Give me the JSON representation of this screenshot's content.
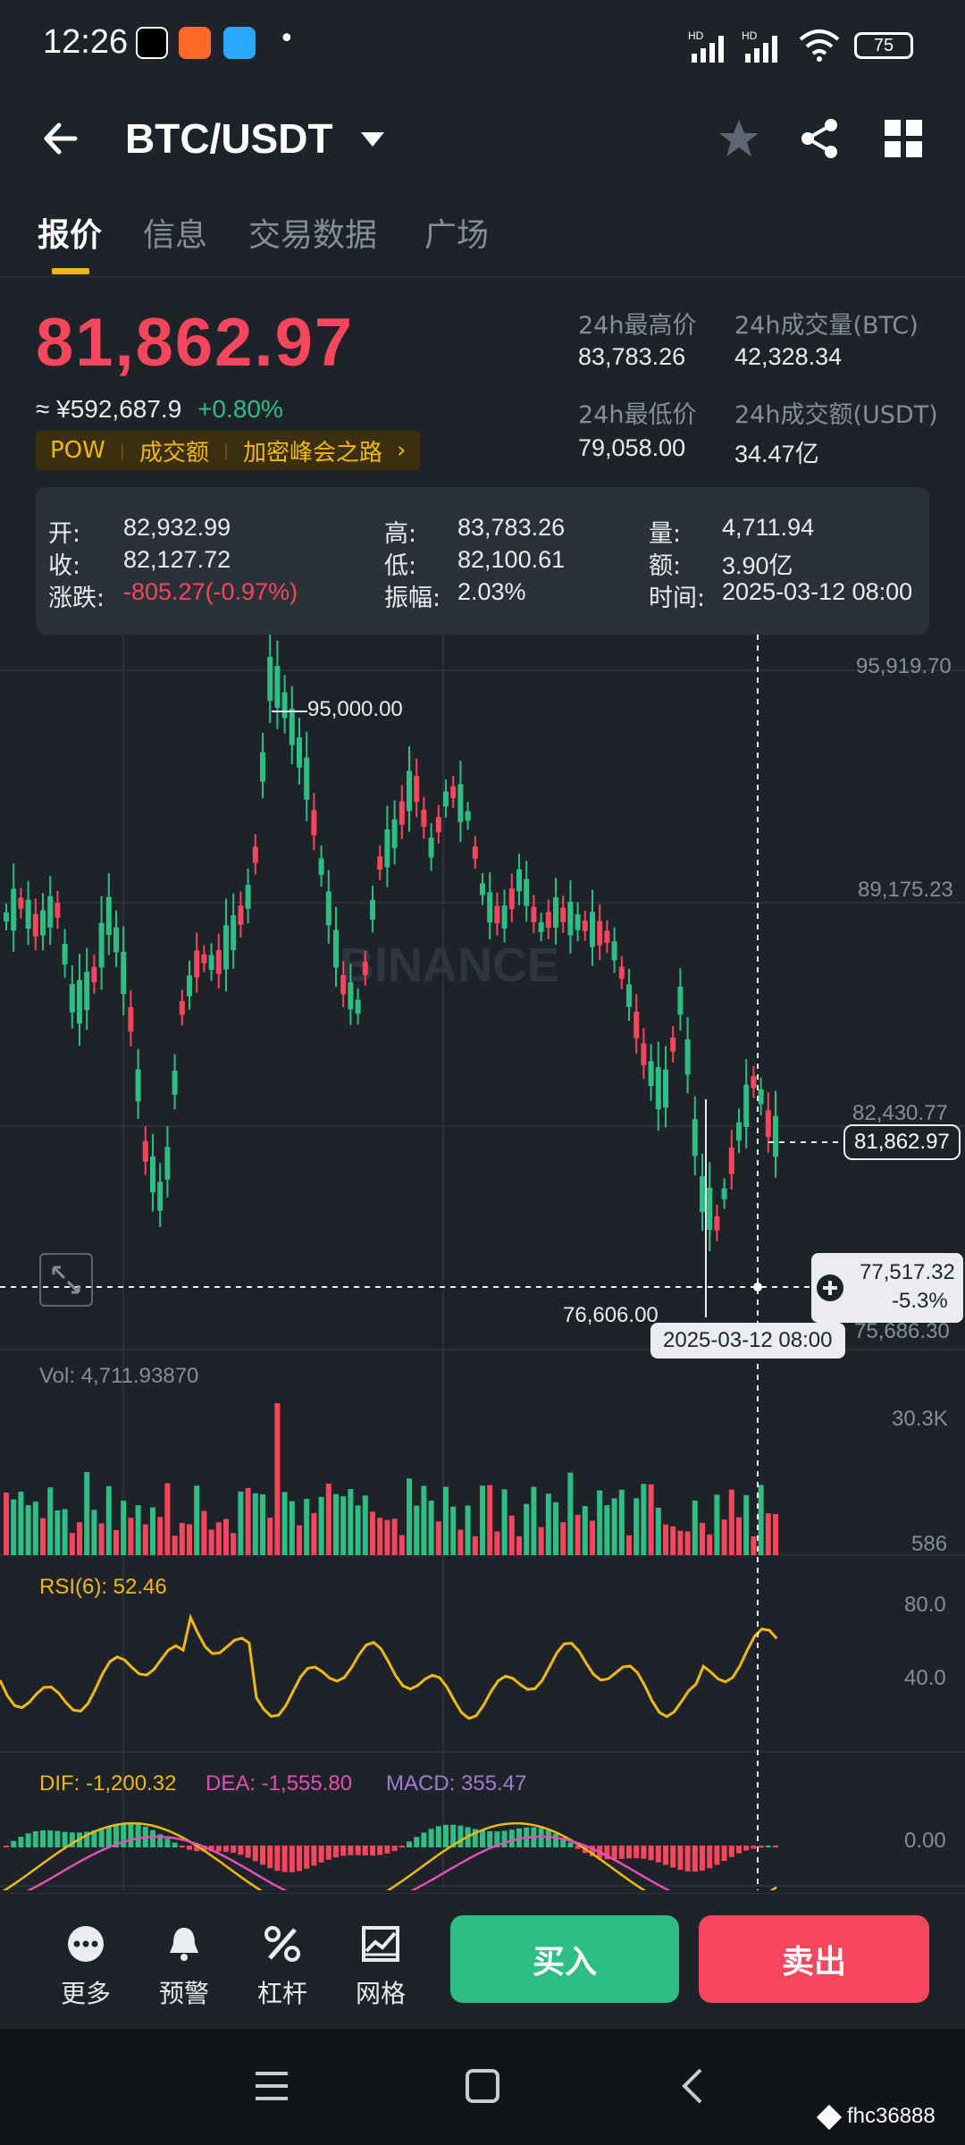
{
  "status_bar": {
    "time": "12:26",
    "battery": "75",
    "dot": "•"
  },
  "header": {
    "pair": "BTC/USDT",
    "back_icon": "arrow-left-icon",
    "star_icon": "star-icon",
    "share_icon": "share-icon",
    "grid_icon": "grid-icon"
  },
  "tabs": [
    {
      "label": "报价",
      "active": true
    },
    {
      "label": "信息",
      "active": false
    },
    {
      "label": "交易数据",
      "active": false
    },
    {
      "label": "广场",
      "active": false
    }
  ],
  "ticker": {
    "last_price": "81,862.97",
    "cny_price": "≈ ¥592,687.9",
    "change_pct": "+0.80%",
    "tags": [
      "POW",
      "成交额",
      "加密峰会之路"
    ],
    "tag_arrow": "›",
    "high_24h_label": "24h最高价",
    "high_24h": "83,783.26",
    "low_24h_label": "24h最低价",
    "low_24h": "79,058.00",
    "vol_btc_label": "24h成交量(BTC)",
    "vol_btc": "42,328.34",
    "vol_usdt_label": "24h成交额(USDT)",
    "vol_usdt": "34.47亿"
  },
  "ohlc_panel": {
    "open_label": "开:",
    "open": "82,932.99",
    "close_label": "收:",
    "close": "82,127.72",
    "change_label": "涨跌:",
    "change": "-805.27(-0.97%)",
    "high_label": "高:",
    "high": "83,783.26",
    "low_label": "低:",
    "low": "82,100.61",
    "amp_label": "振幅:",
    "amp": "2.03%",
    "vol_label": "量:",
    "vol": "4,711.94",
    "amount_label": "额:",
    "amount": "3.90亿",
    "time_label": "时间:",
    "time": "2025-03-12 08:00"
  },
  "chart_labels": {
    "axis_1": "95,919.70",
    "axis_2": "89,175.23",
    "axis_3": "82,430.77",
    "axis_4": "75,686.30",
    "max_marker": "95,000.00",
    "min_marker": "76,606.00",
    "current_price_tag": "81,862.97",
    "crosshair_price": "77,517.32",
    "crosshair_pct": "-5.3%",
    "crosshair_date": "2025-03-12 08:00",
    "watermark": "BINANCE",
    "vol_title": "Vol: 4,711.93870",
    "vol_axis_top": "30.3K",
    "vol_axis_bottom": "586",
    "rsi_title": "RSI(6): 52.46",
    "rsi_axis_top": "80.0",
    "rsi_axis_mid": "40.0",
    "macd_dif": "DIF: -1,200.32",
    "macd_dea": "DEA: -1,555.80",
    "macd_val": "MACD: 355.47",
    "macd_axis": "0.00"
  },
  "colors": {
    "up": "#2ebd85",
    "down": "#f6465d",
    "accent": "#f0b90b",
    "rsi": "#f0b90b",
    "dea": "#e44fb4",
    "macd": "#9e7ed1"
  },
  "bottom_nav": {
    "items": [
      {
        "label": "更多",
        "icon": "more-icon"
      },
      {
        "label": "预警",
        "icon": "bell-icon"
      },
      {
        "label": "杠杆",
        "icon": "leverage-icon"
      },
      {
        "label": "网格",
        "icon": "grid-chart-icon"
      }
    ],
    "buy": "买入",
    "sell": "卖出"
  },
  "footer_watermark": "fhc36888"
}
